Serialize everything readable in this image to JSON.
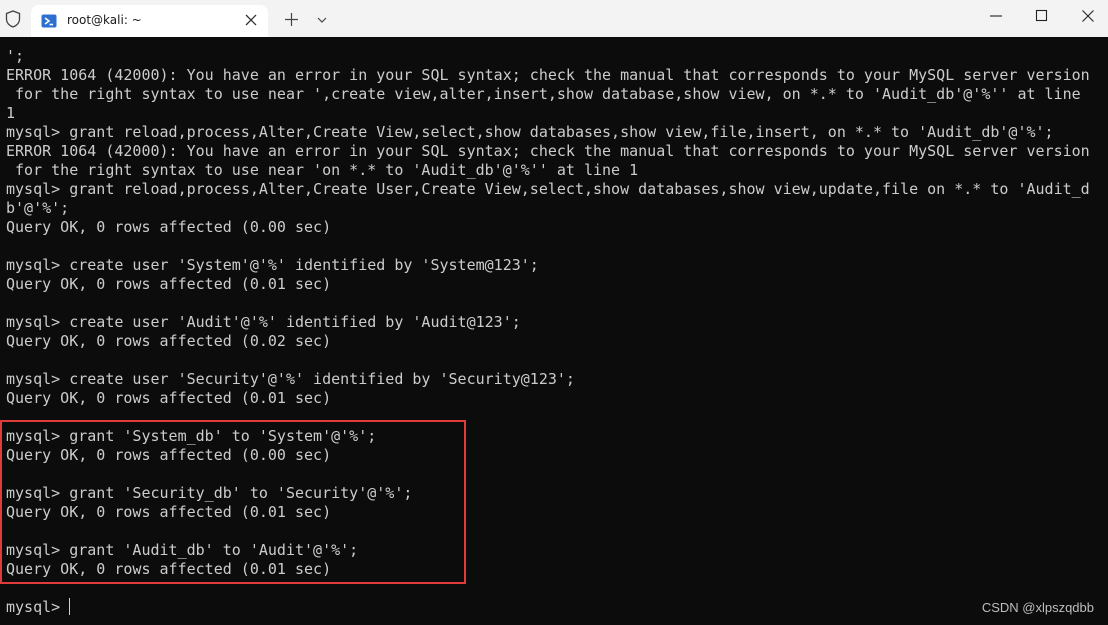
{
  "tab": {
    "title": "root@kali: ~"
  },
  "terminal": {
    "lines": [
      "';",
      "ERROR 1064 (42000): You have an error in your SQL syntax; check the manual that corresponds to your MySQL server version",
      " for the right syntax to use near ',create view,alter,insert,show database,show view, on *.* to 'Audit_db'@'%'' at line",
      "1",
      "mysql> grant reload,process,Alter,Create View,select,show databases,show view,file,insert, on *.* to 'Audit_db'@'%';",
      "ERROR 1064 (42000): You have an error in your SQL syntax; check the manual that corresponds to your MySQL server version",
      " for the right syntax to use near 'on *.* to 'Audit_db'@'%'' at line 1",
      "mysql> grant reload,process,Alter,Create User,Create View,select,show databases,show view,update,file on *.* to 'Audit_d",
      "b'@'%';",
      "Query OK, 0 rows affected (0.00 sec)",
      "",
      "mysql> create user 'System'@'%' identified by 'System@123';",
      "Query OK, 0 rows affected (0.01 sec)",
      "",
      "mysql> create user 'Audit'@'%' identified by 'Audit@123';",
      "Query OK, 0 rows affected (0.02 sec)",
      "",
      "mysql> create user 'Security'@'%' identified by 'Security@123';",
      "Query OK, 0 rows affected (0.01 sec)",
      "",
      "mysql> grant 'System_db' to 'System'@'%';",
      "Query OK, 0 rows affected (0.00 sec)",
      "",
      "mysql> grant 'Security_db' to 'Security'@'%';",
      "Query OK, 0 rows affected (0.01 sec)",
      "",
      "mysql> grant 'Audit_db' to 'Audit'@'%';",
      "Query OK, 0 rows affected (0.01 sec)",
      ""
    ],
    "prompt": "mysql> "
  },
  "watermark": "CSDN @xlpszqdbb",
  "icons": {
    "shield": "shield-icon",
    "tab": "powershell-icon",
    "tab_close": "close-icon",
    "new_tab": "plus-icon",
    "dropdown": "chevron-down-icon",
    "minimize": "minimize-icon",
    "maximize": "maximize-icon",
    "close": "close-icon"
  },
  "colors": {
    "terminal_bg": "#0c0c0c",
    "terminal_text": "#cccccc",
    "titlebar_bg": "#f3f3f3",
    "highlight": "#e23b3b",
    "tab_icon": "#2c6fcf"
  }
}
